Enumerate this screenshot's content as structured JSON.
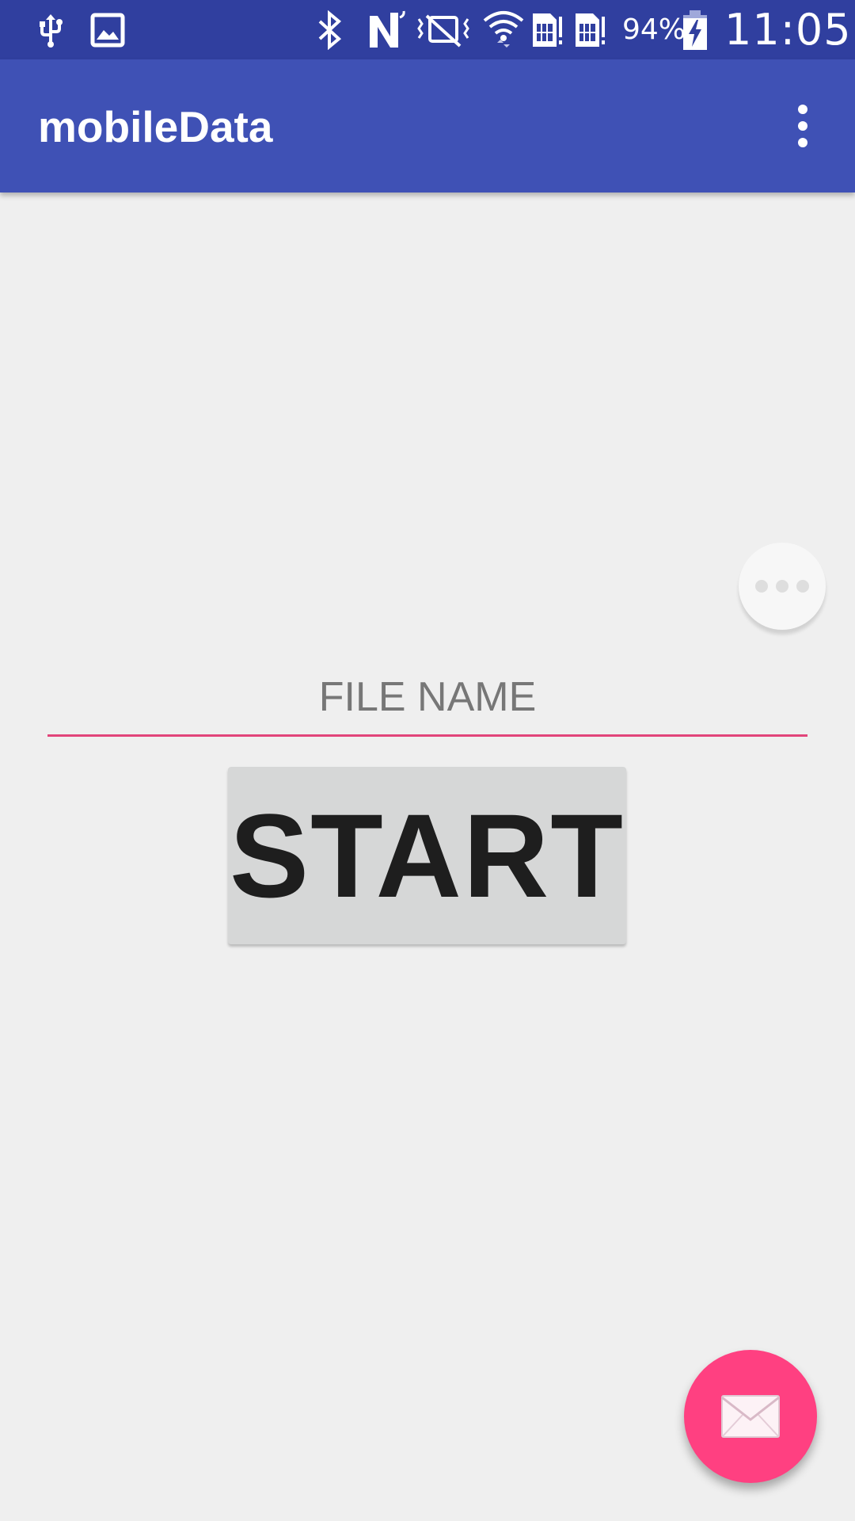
{
  "status_bar": {
    "battery_percent": "94%",
    "time": "11:05",
    "icons": [
      "usb-icon",
      "image-icon",
      "bluetooth-icon",
      "nfc-icon",
      "vibrate-off-icon",
      "wifi-icon",
      "sim1-icon",
      "sim2-icon",
      "battery-charging-icon"
    ]
  },
  "app_bar": {
    "title": "mobileData",
    "menu_icon": "more-vert-icon"
  },
  "floating_more": {
    "icon": "more-horiz-icon"
  },
  "form": {
    "file_name_placeholder": "FILE NAME",
    "file_name_value": "",
    "start_label": "START"
  },
  "fab": {
    "icon": "mail-icon"
  },
  "colors": {
    "status_bar": "#303f9f",
    "app_bar": "#3f51b5",
    "accent": "#ff4081",
    "background": "#efefef",
    "button": "#d6d7d7"
  }
}
